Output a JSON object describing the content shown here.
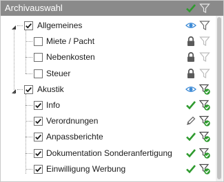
{
  "header": {
    "title": "Archivauswahl"
  },
  "tree": [
    {
      "label": "Allgemeines",
      "level": 0,
      "checked": true,
      "expanded": true,
      "icon": "eye-icon",
      "filter": "filter-icon"
    },
    {
      "label": "Miete / Pacht",
      "level": 1,
      "checked": false,
      "icon": "lock-icon",
      "filter": "filter-icon-light"
    },
    {
      "label": "Nebenkosten",
      "level": 1,
      "checked": false,
      "icon": "lock-icon",
      "filter": "filter-icon-light"
    },
    {
      "label": "Steuer",
      "level": 1,
      "checked": false,
      "icon": "lock-icon",
      "filter": "filter-icon-light"
    },
    {
      "label": "Akustik",
      "level": 0,
      "checked": true,
      "expanded": true,
      "icon": "eye-icon",
      "filter": "filter-check-icon"
    },
    {
      "label": "Info",
      "level": 1,
      "checked": true,
      "icon": "checkmark-icon",
      "filter": "filter-check-icon"
    },
    {
      "label": "Verordnungen",
      "level": 1,
      "checked": true,
      "icon": "pencil-icon",
      "filter": "filter-check-icon"
    },
    {
      "label": "Anpassberichte",
      "level": 1,
      "checked": true,
      "icon": "checkmark-icon",
      "filter": "filter-check-icon"
    },
    {
      "label": "Dokumentation Sonderanfertigung",
      "level": 1,
      "checked": true,
      "icon": "checkmark-icon",
      "filter": "filter-check-icon"
    },
    {
      "label": "Einwilligung Werbung",
      "level": 1,
      "checked": true,
      "icon": "checkmark-icon",
      "filter": "filter-check-icon"
    }
  ]
}
